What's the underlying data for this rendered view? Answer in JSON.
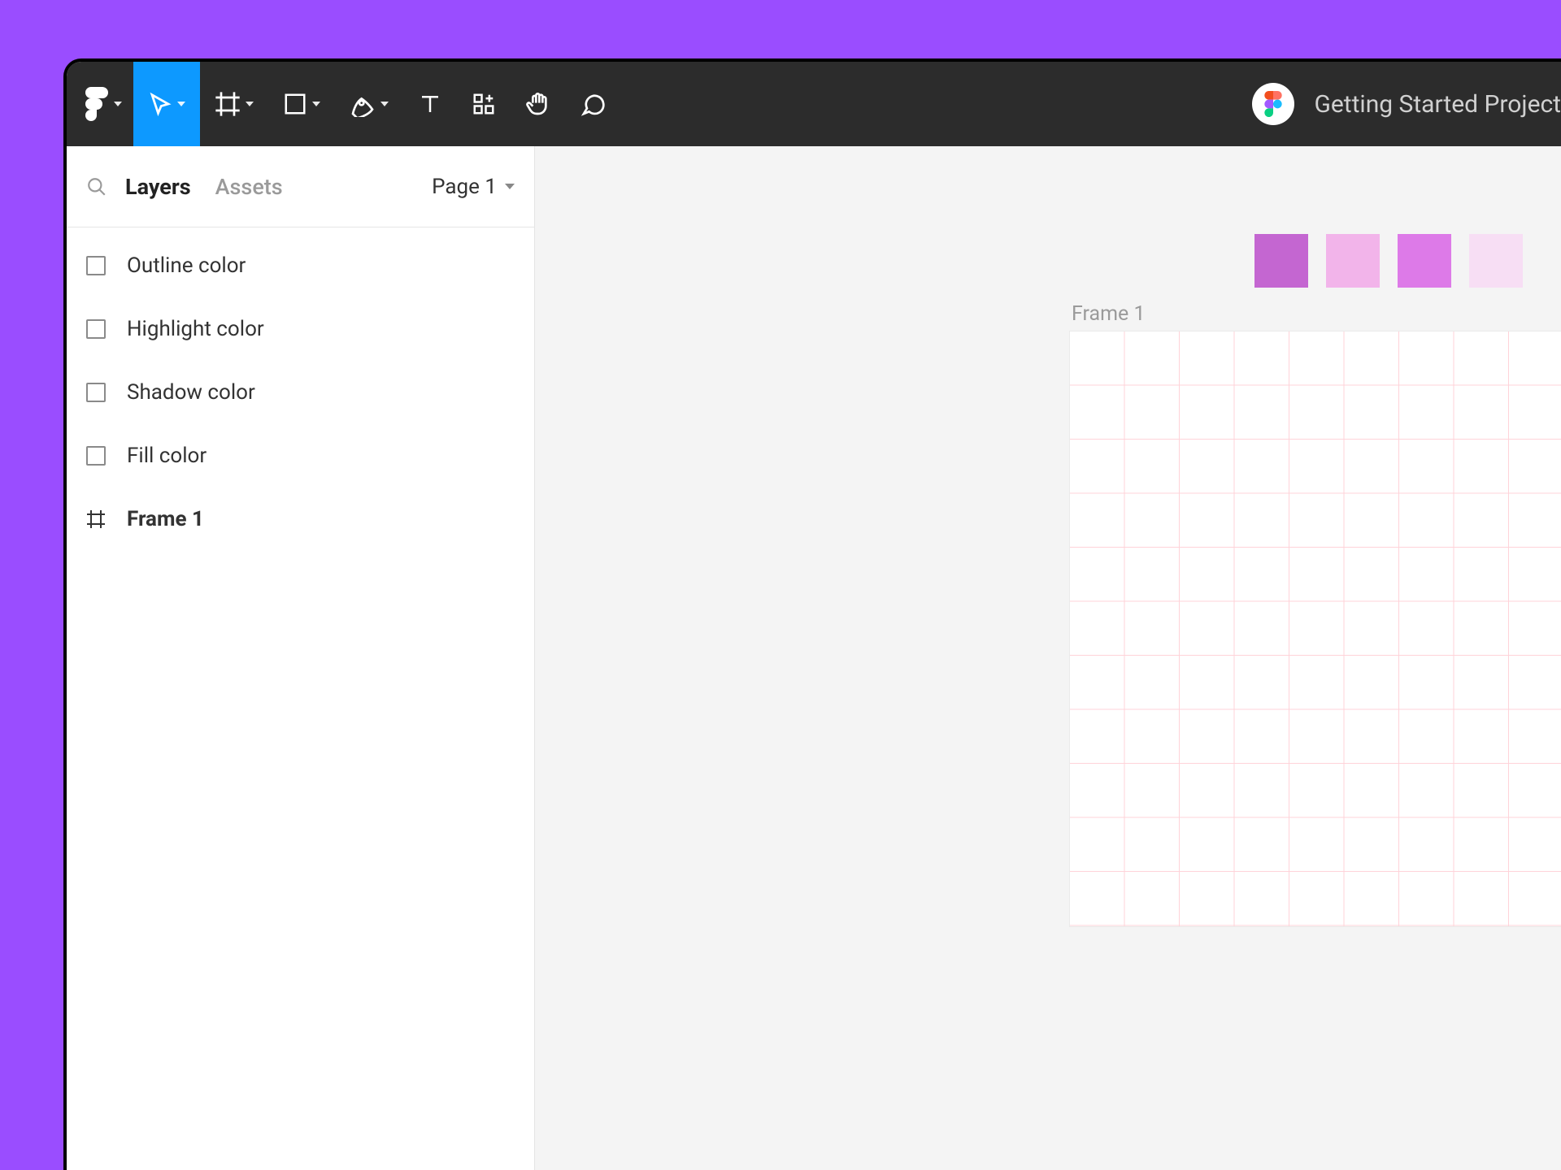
{
  "toolbar": {
    "project_title": "Getting Started Project"
  },
  "sidebar": {
    "tabs": {
      "layers": "Layers",
      "assets": "Assets"
    },
    "page_selector": "Page 1",
    "layers": [
      {
        "label": "Outline color",
        "kind": "square",
        "bold": false
      },
      {
        "label": "Highlight color",
        "kind": "square",
        "bold": false
      },
      {
        "label": "Shadow color",
        "kind": "square",
        "bold": false
      },
      {
        "label": "Fill color",
        "kind": "square",
        "bold": false
      },
      {
        "label": "Frame 1",
        "kind": "frame",
        "bold": true
      }
    ]
  },
  "canvas": {
    "frame_label": "Frame 1",
    "swatches": [
      "#c466d1",
      "#f2b4ea",
      "#dd7ae8",
      "#f7def4"
    ]
  }
}
